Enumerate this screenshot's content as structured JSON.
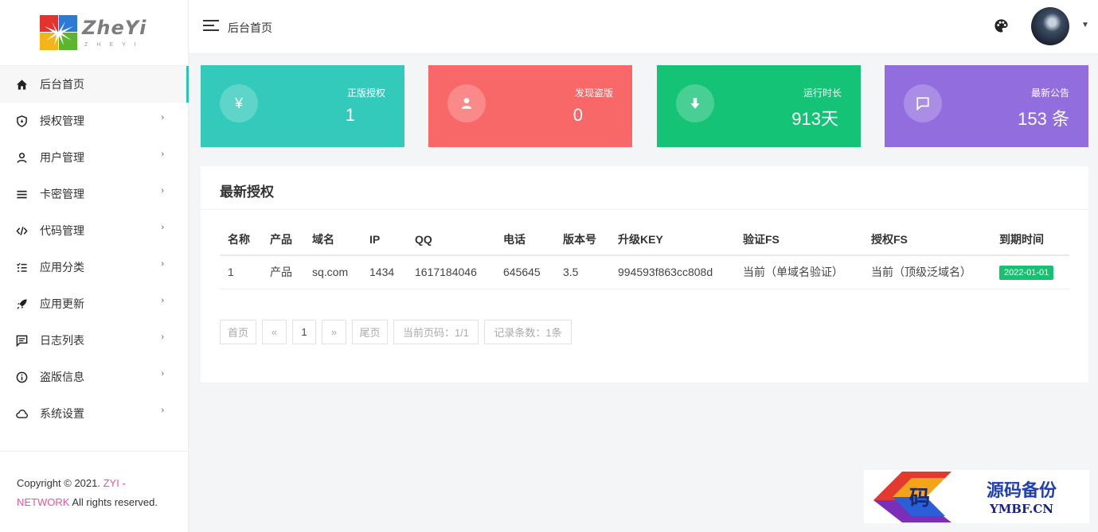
{
  "brand": {
    "name": "ZheYi",
    "sub": "ZHEYI",
    "colors": {
      "red": "#e5322d",
      "blue": "#2b7ad6",
      "yellow": "#f5b51a",
      "green": "#5cb531"
    }
  },
  "sidebar": {
    "items": [
      {
        "label": "后台首页",
        "icon": "home-icon",
        "active": true
      },
      {
        "label": "授权管理",
        "icon": "shield-icon"
      },
      {
        "label": "用户管理",
        "icon": "user-icon"
      },
      {
        "label": "卡密管理",
        "icon": "menu-lines-icon"
      },
      {
        "label": "代码管理",
        "icon": "code-icon"
      },
      {
        "label": "应用分类",
        "icon": "list-check-icon"
      },
      {
        "label": "应用更新",
        "icon": "rocket-icon"
      },
      {
        "label": "日志列表",
        "icon": "comment-icon"
      },
      {
        "label": "盗版信息",
        "icon": "info-icon"
      },
      {
        "label": "系统设置",
        "icon": "cloud-icon"
      }
    ],
    "arrow": "›"
  },
  "footer": {
    "copyright": "Copyright © 2021. ",
    "zyi": "ZYI -",
    "network": "NETWORK",
    "rights": " All rights reserved."
  },
  "header": {
    "title": "后台首页",
    "caret": "▼"
  },
  "stats": [
    {
      "label": "正版授权",
      "value": "1",
      "icon": "yen-icon",
      "color": "#33cabb"
    },
    {
      "label": "发现盗版",
      "value": "0",
      "icon": "user-icon",
      "color": "#f96868"
    },
    {
      "label": "运行时长",
      "value": "913天",
      "icon": "arrow-down-icon",
      "color": "#15c377"
    },
    {
      "label": "最新公告",
      "value": "153 条",
      "icon": "chat-icon",
      "color": "#926dde"
    }
  ],
  "panel": {
    "title": "最新授权",
    "columns": [
      "名称",
      "产品",
      "域名",
      "IP",
      "QQ",
      "电话",
      "版本号",
      "升级KEY",
      "验证FS",
      "授权FS",
      "到期时间"
    ],
    "rows": [
      [
        "1",
        "产品",
        "sq.com",
        "1434",
        "1617184046",
        "645645",
        "3.5",
        "994593f863cc808d",
        "当前（单域名验证）",
        "当前（顶级泛域名）",
        "2022-01-01"
      ]
    ],
    "pager": {
      "first": "首页",
      "prev": "«",
      "current": "1",
      "next": "»",
      "last": "尾页",
      "page_info": "当前页码：1/1",
      "count_info": "记录条数：1条"
    }
  },
  "watermark": {
    "glyph": "码",
    "title": "源码备份",
    "domain": "YMBF.CN"
  }
}
